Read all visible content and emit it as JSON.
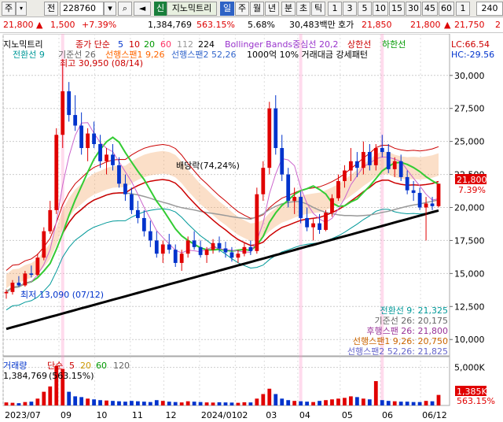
{
  "toolbar": {
    "market_btn": "주",
    "market_dropdown": "▾",
    "code_type": "전",
    "code": "228760",
    "search_icon": "search-icon",
    "checkbox": "▢",
    "sound_icon": "speaker-icon",
    "new_badge": "신",
    "indicator": "지노믹트리",
    "periods": [
      "일",
      "주",
      "월",
      "년",
      "분",
      "초",
      "틱"
    ],
    "active_period": "일",
    "intervals": [
      "1",
      "3",
      "5",
      "10",
      "15",
      "30",
      "45",
      "60",
      "1",
      "240"
    ]
  },
  "quote": {
    "price": "21,800",
    "arrow": "▲",
    "change": "1,500",
    "change_pct": "+7.39%",
    "volume": "1,384,769",
    "volume_ratio": "563.15%",
    "turnover": "5.68%",
    "amount": "30,483백만",
    "ask_label": "호가",
    "ask": "21,850",
    "bid": "21,800",
    "bid_change": "▲",
    "bid_value": "21,750",
    "last": "2"
  },
  "legend": {
    "name": "지노믹트리",
    "ma_title": "종가 단순",
    "ma_periods": [
      "5",
      "10",
      "20",
      "60",
      "112",
      "224"
    ],
    "ma_colors": [
      "#0033cc",
      "#cc0000",
      "#009900",
      "#ff3366",
      "#999999",
      "#000000"
    ],
    "bollinger": "Bollinger Bands중심선 20,2",
    "upper": "상한선",
    "lower": "하한선",
    "ichimoku": "전환선 9",
    "base": "기준선 26",
    "lead1": "선행스팬1 9,26",
    "lead2": "선행스팬2 52,26",
    "pattern": "1000억 10% 거래대금 강세패턴",
    "lc": "LC:66.54",
    "hc": "HC:-29.56"
  },
  "annotations": {
    "high": "최고 30,950 (08/14)",
    "low": "최저 13,090 (07/12)",
    "ex_rights": "배당락(74,24%)",
    "current_price": "21,800",
    "current_pct": "7.39%",
    "volume_current": "1,385K",
    "volume_pct": "563.15%"
  },
  "ichimoku_readout": [
    {
      "label": "전환선 9: 21,325",
      "color": "#009999"
    },
    {
      "label": "기준선 26: 20,175",
      "color": "#666666"
    },
    {
      "label": "후행스팬 26: 21,800",
      "color": "#993399"
    },
    {
      "label": "선행스팬1 9,26: 20,750",
      "color": "#cc6600"
    },
    {
      "label": "선행스팬2 52,26: 21,825",
      "color": "#6666cc"
    }
  ],
  "volume_legend": {
    "title": "거래량",
    "ma": "단순",
    "periods": [
      "5",
      "20",
      "60",
      "120"
    ],
    "period_colors": [
      "#cc0000",
      "#cc9900",
      "#009900",
      "#666666"
    ],
    "value": "1,384,769",
    "ratio": "(563.15%)"
  },
  "chart_data": {
    "type": "candlestick",
    "price_axis": {
      "ticks": [
        10000,
        12500,
        15000,
        17500,
        20000,
        22500,
        25000,
        27500,
        30000
      ],
      "min": 9000,
      "max": 31000
    },
    "volume_axis": {
      "ticks": [
        "5,000K"
      ],
      "max": 6000
    },
    "x_axis_labels": [
      "2023/07",
      "09",
      "10",
      "11",
      "12",
      "2024/01",
      "02",
      "03",
      "04",
      "05",
      "06",
      "06/12"
    ],
    "candles": [
      [
        13500,
        13800,
        13090,
        13600
      ],
      [
        13600,
        14500,
        13400,
        14300
      ],
      [
        14300,
        14800,
        14000,
        14100
      ],
      [
        14100,
        15200,
        14000,
        15000
      ],
      [
        15000,
        15600,
        14700,
        14900
      ],
      [
        14900,
        16500,
        14800,
        16200
      ],
      [
        16200,
        18500,
        16000,
        18200
      ],
      [
        18200,
        20500,
        18000,
        19800
      ],
      [
        19800,
        26000,
        19500,
        25500
      ],
      [
        25500,
        30950,
        24500,
        28800
      ],
      [
        28800,
        29500,
        26500,
        27000
      ],
      [
        27000,
        28500,
        25800,
        26200
      ],
      [
        26200,
        27200,
        24000,
        24500
      ],
      [
        24500,
        26000,
        23500,
        25600
      ],
      [
        25600,
        26500,
        24500,
        24800
      ],
      [
        24800,
        25500,
        23000,
        23500
      ],
      [
        23500,
        24500,
        22500,
        24000
      ],
      [
        24000,
        24800,
        22800,
        23200
      ],
      [
        23200,
        23800,
        21500,
        21800
      ],
      [
        21800,
        22500,
        20500,
        21000
      ],
      [
        21000,
        21500,
        19500,
        19800
      ],
      [
        19800,
        20500,
        18800,
        19200
      ],
      [
        19200,
        19800,
        17800,
        18200
      ],
      [
        18200,
        19000,
        17000,
        17500
      ],
      [
        17500,
        18200,
        16200,
        16500
      ],
      [
        16500,
        17500,
        15800,
        17200
      ],
      [
        17200,
        18000,
        16500,
        16800
      ],
      [
        16800,
        17200,
        15500,
        15800
      ],
      [
        15800,
        16800,
        15200,
        16500
      ],
      [
        16500,
        17800,
        16200,
        17500
      ],
      [
        17500,
        18200,
        16800,
        17000
      ],
      [
        17000,
        17500,
        16200,
        16400
      ],
      [
        16400,
        17000,
        15800,
        16800
      ],
      [
        16800,
        17600,
        16500,
        17300
      ],
      [
        17300,
        17800,
        16600,
        16900
      ],
      [
        16900,
        17400,
        16200,
        16600
      ],
      [
        16600,
        17000,
        15900,
        16200
      ],
      [
        16200,
        16800,
        15800,
        16500
      ],
      [
        16500,
        17300,
        16300,
        17000
      ],
      [
        17000,
        17500,
        16400,
        16700
      ],
      [
        16700,
        21500,
        16500,
        21000
      ],
      [
        21000,
        23500,
        20500,
        23000
      ],
      [
        23000,
        28000,
        22500,
        27500
      ],
      [
        27500,
        28500,
        24000,
        24500
      ],
      [
        24500,
        25500,
        22000,
        22500
      ],
      [
        22500,
        23000,
        20000,
        20500
      ],
      [
        20500,
        21500,
        19500,
        20800
      ],
      [
        20800,
        21200,
        18800,
        19200
      ],
      [
        19200,
        20000,
        18200,
        18500
      ],
      [
        18500,
        19200,
        17500,
        18800
      ],
      [
        18800,
        19500,
        18000,
        18300
      ],
      [
        18300,
        19800,
        18200,
        19600
      ],
      [
        19600,
        21000,
        19300,
        20700
      ],
      [
        20700,
        22500,
        20500,
        22000
      ],
      [
        22000,
        23200,
        21500,
        22800
      ],
      [
        22800,
        24500,
        22000,
        23500
      ],
      [
        23500,
        24200,
        22300,
        23000
      ],
      [
        23000,
        25000,
        22500,
        24200
      ],
      [
        24200,
        24800,
        22800,
        23200
      ],
      [
        23200,
        24800,
        22800,
        24500
      ],
      [
        24500,
        25500,
        23800,
        24200
      ],
      [
        24200,
        24800,
        22600,
        22900
      ],
      [
        22900,
        23800,
        22300,
        23500
      ],
      [
        23500,
        24000,
        22000,
        22300
      ],
      [
        22300,
        22800,
        21000,
        21300
      ],
      [
        21300,
        22000,
        20500,
        21100
      ],
      [
        21100,
        21500,
        19800,
        20000
      ],
      [
        20000,
        20800,
        17500,
        20300
      ],
      [
        20300,
        20800,
        19800,
        20100
      ],
      [
        20100,
        21800,
        20000,
        21800
      ]
    ],
    "volumes": [
      400,
      350,
      300,
      450,
      500,
      900,
      1800,
      2500,
      5200,
      4800,
      1800,
      1200,
      1100,
      900,
      800,
      700,
      650,
      600,
      550,
      500,
      600,
      550,
      500,
      450,
      700,
      600,
      500,
      450,
      400,
      550,
      500,
      450,
      400,
      380,
      420,
      400,
      380,
      350,
      420,
      400,
      900,
      1500,
      2200,
      1500,
      900,
      700,
      600,
      550,
      500,
      450,
      600,
      700,
      800,
      900,
      1000,
      1200,
      1100,
      900,
      800,
      3200,
      700,
      600,
      550,
      500,
      500,
      450,
      450,
      600,
      550,
      1385
    ]
  }
}
